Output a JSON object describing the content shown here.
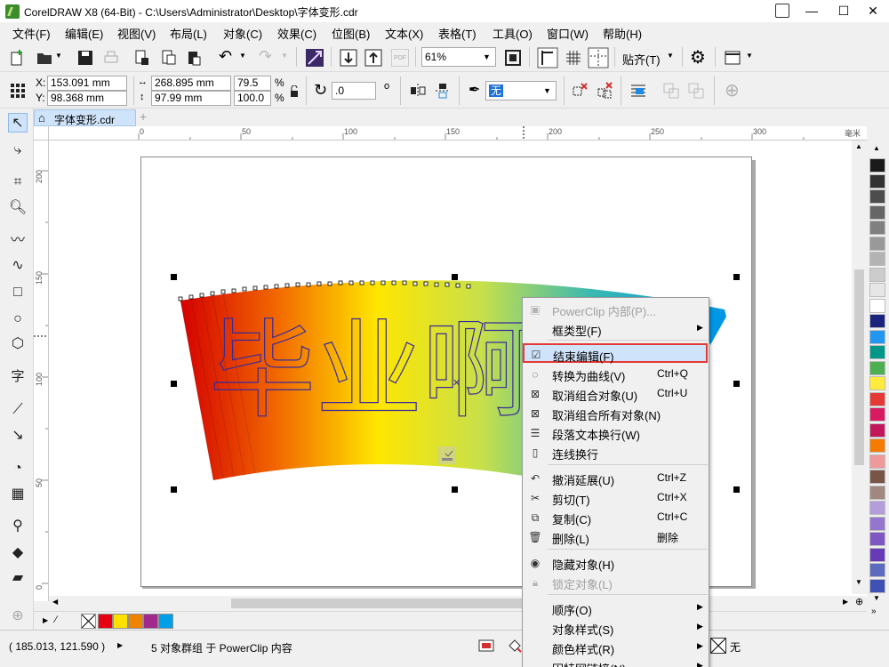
{
  "window": {
    "title": "CorelDRAW X8 (64-Bit) - C:\\Users\\Administrator\\Desktop\\字体变形.cdr",
    "minimize": "—",
    "maximize": "☐",
    "close": "✕"
  },
  "menubar": {
    "items": [
      "文件(F)",
      "编辑(E)",
      "视图(V)",
      "布局(L)",
      "对象(C)",
      "效果(C)",
      "位图(B)",
      "文本(X)",
      "表格(T)",
      "工具(O)",
      "窗口(W)",
      "帮助(H)"
    ]
  },
  "std_toolbar": {
    "pdf_label": "PDF",
    "zoom_value": "61%",
    "snap_label": "贴齐(T)"
  },
  "prop_toolbar": {
    "x_label": "X:",
    "x_value": "153.091 mm",
    "y_label": "Y:",
    "y_value": "98.368 mm",
    "w_value": "268.895 mm",
    "h_value": "97.99 mm",
    "scale_w": "79.5",
    "scale_h": "100.0",
    "percent": "%",
    "rotation": ".0",
    "degree": "o",
    "outline_value": "无"
  },
  "document": {
    "tab_label": "字体变形.cdr",
    "add_tab": "+",
    "artwork_text": "毕业啊"
  },
  "ruler": {
    "top_labels": [
      "0",
      "50",
      "100",
      "150",
      "200",
      "250",
      "300"
    ],
    "unit": "毫米",
    "left_labels": [
      "200",
      "150",
      "100",
      "50",
      "0"
    ]
  },
  "context_menu": {
    "items": [
      {
        "icon": "powerclip-icon",
        "label": "PowerClip 内部(P)...",
        "shortcut": "",
        "disabled": true,
        "submenu": false
      },
      {
        "icon": "",
        "label": "框类型(F)",
        "shortcut": "",
        "disabled": false,
        "submenu": true
      },
      {
        "icon": "finish-edit-icon",
        "label": "结束编辑(F)",
        "shortcut": "",
        "disabled": false,
        "submenu": false,
        "highlighted": true
      },
      {
        "icon": "convert-curve-icon",
        "label": "转换为曲线(V)",
        "shortcut": "Ctrl+Q",
        "disabled": false,
        "submenu": false
      },
      {
        "icon": "ungroup-icon",
        "label": "取消组合对象(U)",
        "shortcut": "Ctrl+U",
        "disabled": false,
        "submenu": false
      },
      {
        "icon": "ungroup-all-icon",
        "label": "取消组合所有对象(N)",
        "shortcut": "",
        "disabled": false,
        "submenu": false
      },
      {
        "icon": "paragraph-wrap-icon",
        "label": "段落文本换行(W)",
        "shortcut": "",
        "disabled": false,
        "submenu": false
      },
      {
        "icon": "connector-wrap-icon",
        "label": "连线换行",
        "shortcut": "",
        "disabled": false,
        "submenu": false
      },
      {
        "icon": "undo-icon",
        "label": "撤消延展(U)",
        "shortcut": "Ctrl+Z",
        "disabled": false,
        "submenu": false
      },
      {
        "icon": "cut-icon",
        "label": "剪切(T)",
        "shortcut": "Ctrl+X",
        "disabled": false,
        "submenu": false
      },
      {
        "icon": "copy-icon",
        "label": "复制(C)",
        "shortcut": "Ctrl+C",
        "disabled": false,
        "submenu": false
      },
      {
        "icon": "delete-icon",
        "label": "删除(L)",
        "shortcut": "删除",
        "disabled": false,
        "submenu": false
      },
      {
        "icon": "hide-object-icon",
        "label": "隐藏对象(H)",
        "shortcut": "",
        "disabled": false,
        "submenu": false
      },
      {
        "icon": "lock-icon",
        "label": "锁定对象(L)",
        "shortcut": "",
        "disabled": true,
        "submenu": false
      },
      {
        "icon": "",
        "label": "顺序(O)",
        "shortcut": "",
        "disabled": false,
        "submenu": true
      },
      {
        "icon": "",
        "label": "对象样式(S)",
        "shortcut": "",
        "disabled": false,
        "submenu": true
      },
      {
        "icon": "",
        "label": "颜色样式(R)",
        "shortcut": "",
        "disabled": false,
        "submenu": true
      },
      {
        "icon": "",
        "label": "因特网链接(N)",
        "shortcut": "",
        "disabled": false,
        "submenu": true
      }
    ]
  },
  "statusbar": {
    "coords": "( 185.013, 121.590 )",
    "message": "5 对象群组 于 PowerClip 内容",
    "fill_label": "无"
  },
  "palette_colors": [
    "#1a1a1a",
    "#333333",
    "#4d4d4d",
    "#666666",
    "#808080",
    "#999999",
    "#b3b3b3",
    "#cccccc",
    "#e6e6e6",
    "#ffffff",
    "#1a237e",
    "#2196f3",
    "#009688",
    "#4caf50",
    "#ffeb3b",
    "#e53935",
    "#d81b60",
    "#c2185b",
    "#f57c00",
    "#ef9a9a",
    "#795548",
    "#a1887f",
    "#b39ddb",
    "#9575cd",
    "#7e57c2",
    "#673ab7",
    "#5c6bc0",
    "#3f51b5"
  ],
  "doc_palette_colors": [
    "#e50012",
    "#ffe100",
    "#f08300",
    "#a0298d",
    "#00a0e9"
  ]
}
